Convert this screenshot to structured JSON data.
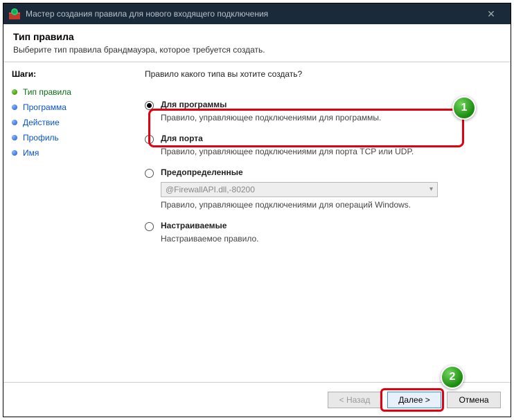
{
  "titlebar": {
    "title": "Мастер создания правила для нового входящего подключения"
  },
  "header": {
    "title": "Тип правила",
    "subtitle": "Выберите тип правила брандмауэра, которое требуется создать."
  },
  "sidebar": {
    "title": "Шаги:",
    "items": [
      {
        "label": "Тип правила",
        "active": true
      },
      {
        "label": "Программа",
        "active": false
      },
      {
        "label": "Действие",
        "active": false
      },
      {
        "label": "Профиль",
        "active": false
      },
      {
        "label": "Имя",
        "active": false
      }
    ]
  },
  "content": {
    "question": "Правило какого типа вы хотите создать?",
    "options": [
      {
        "label": "Для программы",
        "desc": "Правило, управляющее подключениями для программы.",
        "checked": true
      },
      {
        "label": "Для порта",
        "desc": "Правило, управляющее подключениями для порта TCP или UDP.",
        "checked": false
      },
      {
        "label": "Предопределенные",
        "desc": "Правило, управляющее подключениями для операций Windows.",
        "checked": false,
        "combo": "@FirewallAPI.dll,-80200"
      },
      {
        "label": "Настраиваемые",
        "desc": "Настраиваемое правило.",
        "checked": false
      }
    ]
  },
  "footer": {
    "back": "< Назад",
    "next": "Далее >",
    "cancel": "Отмена"
  },
  "annotations": {
    "badge1": "1",
    "badge2": "2"
  }
}
